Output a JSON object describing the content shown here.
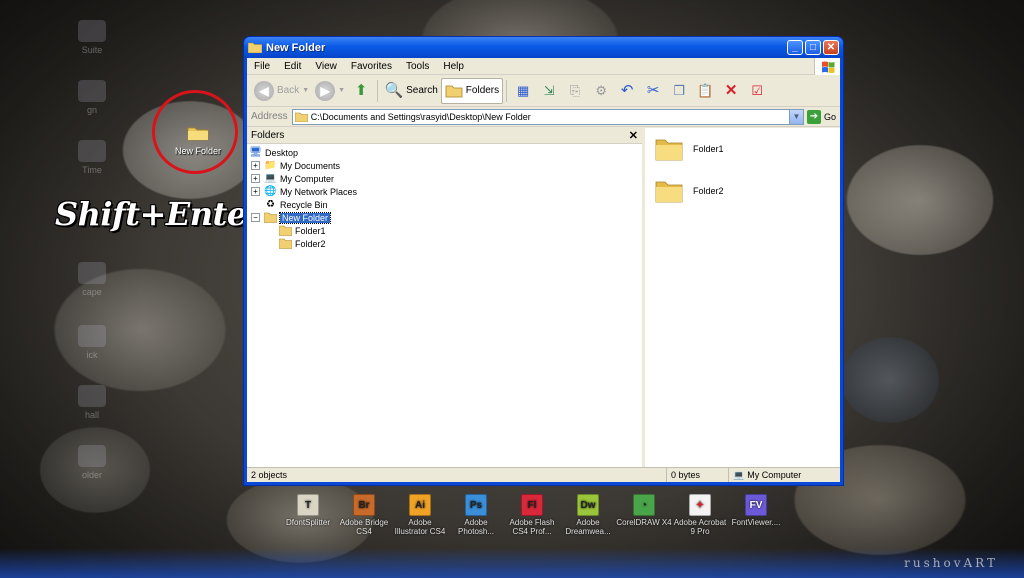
{
  "desktop": {
    "ghost_labels": [
      "Suite",
      "gn",
      "Time",
      "cape",
      "ick",
      "hall",
      "older"
    ],
    "folder_label": "New Folder",
    "shortcut_text": "Shift+Enter",
    "watermark": "rushovART"
  },
  "window": {
    "title": "New Folder",
    "controls": {
      "minimize": "_",
      "maximize": "□",
      "close": "✕"
    },
    "menu": [
      "File",
      "Edit",
      "View",
      "Favorites",
      "Tools",
      "Help"
    ],
    "toolbar": {
      "back": "Back",
      "search": "Search",
      "folders": "Folders"
    },
    "address": {
      "label": "Address",
      "value": "C:\\Documents and Settings\\rasyid\\Desktop\\New Folder",
      "go": "Go"
    },
    "folders_pane": {
      "title": "Folders",
      "close": "✕",
      "tree": [
        {
          "label": "Desktop"
        },
        {
          "label": "My Documents"
        },
        {
          "label": "My Computer"
        },
        {
          "label": "My Network Places"
        },
        {
          "label": "Recycle Bin"
        },
        {
          "label": "New Folder"
        },
        {
          "label": "Folder1"
        },
        {
          "label": "Folder2"
        }
      ]
    },
    "content": [
      "Folder1",
      "Folder2"
    ],
    "status": {
      "objects": "2 objects",
      "size": "0 bytes",
      "location": "My Computer"
    }
  },
  "dock": [
    {
      "label": "DfontSplitter",
      "abbr": "T",
      "color": "#d9d4c4"
    },
    {
      "label": "Adobe Bridge CS4",
      "abbr": "Br",
      "color": "#c86a2a"
    },
    {
      "label": "Adobe Illustrator CS4",
      "abbr": "Ai",
      "color": "#f0a224"
    },
    {
      "label": "Adobe Photosh...",
      "abbr": "Ps",
      "color": "#3a8fd8"
    },
    {
      "label": "Adobe Flash CS4 Prof...",
      "abbr": "Fl",
      "color": "#d8283a"
    },
    {
      "label": "Adobe Dreamwea...",
      "abbr": "Dw",
      "color": "#9ac43a"
    },
    {
      "label": "CorelDRAW X4",
      "abbr": "",
      "color": "#4aa54a"
    },
    {
      "label": "Adobe Acrobat 9 Pro",
      "abbr": "",
      "color": "#f3f3f3"
    },
    {
      "label": "FontViewer....",
      "abbr": "FV",
      "color": "#6a5ad8"
    }
  ]
}
